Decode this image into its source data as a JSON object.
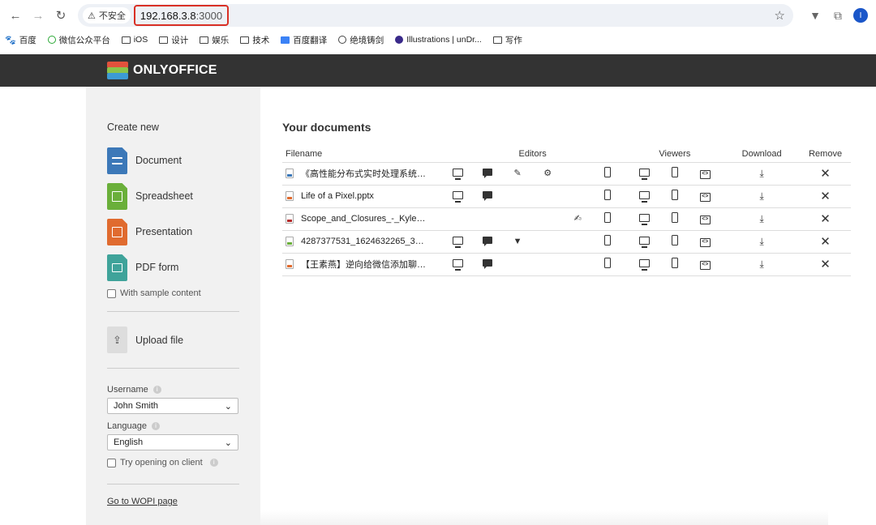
{
  "browser": {
    "security_label": "不安全",
    "url_host": "192.168.3.8",
    "url_port": ":3000",
    "profile_initial": "I"
  },
  "bookmarks": [
    {
      "label": "百度",
      "icon": "baidu-icon"
    },
    {
      "label": "微信公众平台",
      "icon": "wechat-icon"
    },
    {
      "label": "iOS",
      "icon": "folder-icon"
    },
    {
      "label": "设计",
      "icon": "folder-icon"
    },
    {
      "label": "娱乐",
      "icon": "folder-icon"
    },
    {
      "label": "技术",
      "icon": "folder-icon"
    },
    {
      "label": "百度翻译",
      "icon": "translate-icon"
    },
    {
      "label": "绝境铸剑",
      "icon": "globe-icon"
    },
    {
      "label": "Illustrations | unDr...",
      "icon": "undraw-icon"
    },
    {
      "label": "写作",
      "icon": "folder-icon"
    }
  ],
  "app": {
    "brand": "ONLYOFFICE"
  },
  "sidebar": {
    "create_title": "Create new",
    "create_items": [
      "Document",
      "Spreadsheet",
      "Presentation",
      "PDF form"
    ],
    "sample_content_label": "With sample content",
    "upload_label": "Upload file",
    "username_label": "Username",
    "username_value": "John Smith",
    "language_label": "Language",
    "language_value": "English",
    "try_client_label": "Try opening on client",
    "wopi_link": "Go to WOPI page"
  },
  "documents": {
    "title": "Your documents",
    "columns": {
      "filename": "Filename",
      "editors": "Editors",
      "viewers": "Viewers",
      "download": "Download",
      "remove": "Remove"
    },
    "rows": [
      {
        "name": "《高性能分布式实时处理系统编...",
        "type": "doc",
        "editors": [
          "monitor-icon",
          "comment-icon",
          "review-icon",
          "fill-settings-icon",
          "mobile-icon"
        ]
      },
      {
        "name": "Life of a Pixel.pptx",
        "type": "pres",
        "editors": [
          "monitor-icon",
          "comment-icon",
          "mobile-icon"
        ]
      },
      {
        "name": "Scope_and_Closures_-_Kyle_Si...",
        "type": "pdf",
        "editors": [
          "sign-icon",
          "mobile-form-icon"
        ]
      },
      {
        "name": "4287377531_1624632265_3_1...",
        "type": "sheet",
        "editors": [
          "monitor-icon",
          "comment-icon",
          "filter-icon",
          "mobile-icon"
        ]
      },
      {
        "name": "【王素燕】逆向给微信添加聊天...",
        "type": "pres",
        "editors": [
          "monitor-icon",
          "comment-icon",
          "mobile-icon"
        ]
      }
    ]
  },
  "colors": {
    "header_bg": "#333333",
    "url_highlight": "#d93025",
    "doc": "#3c78b8",
    "sheet": "#6aaf3a",
    "pres": "#e06b2f",
    "pdf": "#3fa39a"
  }
}
